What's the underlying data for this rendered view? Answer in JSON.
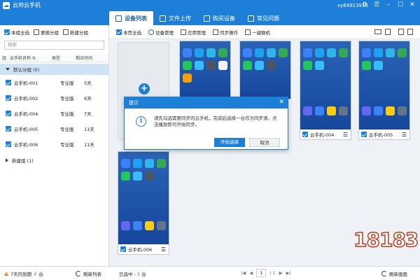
{
  "window": {
    "app_title": "云帅云手机",
    "account": "xy64913915",
    "controls": [
      "⚙",
      "☰",
      "–",
      "☐",
      "✕"
    ]
  },
  "tabs": [
    {
      "label": "设备列表",
      "active": true
    },
    {
      "label": "文件上传",
      "active": false
    },
    {
      "label": "购买设备",
      "active": false
    },
    {
      "label": "常见问题",
      "active": false
    }
  ],
  "left_toolbar": {
    "select_all": "本组全选",
    "change_group": "更换分组",
    "new_group": "新建分组"
  },
  "search": {
    "placeholder": "搜索"
  },
  "columns": {
    "group": "组",
    "name": "云手机名称 ⇅",
    "type": "类型",
    "remaining": "剩余时间"
  },
  "groups": [
    {
      "label": "默认分组 (5)",
      "expanded": true,
      "devices": [
        {
          "name": "云手机-001",
          "type": "专业版",
          "remaining": "5天",
          "checked": true
        },
        {
          "name": "云手机-002",
          "type": "专业版",
          "remaining": "6天",
          "checked": true
        },
        {
          "name": "云手机-004",
          "type": "专业版",
          "remaining": "7天",
          "checked": true
        },
        {
          "name": "云手机-005",
          "type": "专业版",
          "remaining": "11天",
          "checked": true
        },
        {
          "name": "云手机-006",
          "type": "专业版",
          "remaining": "11天",
          "checked": true
        }
      ]
    },
    {
      "label": "新建组 (1)",
      "expanded": false
    }
  ],
  "main_toolbar": {
    "page_select_all": "本页全选",
    "device_manage": "设备管理",
    "app_manage": "应用管理",
    "sync_op": "同步操作",
    "one_key_change": "一键换机"
  },
  "cards": [
    {
      "name": "",
      "visible_footer": false
    },
    {
      "name": "",
      "visible_footer": false
    },
    {
      "name": "云手机-004",
      "visible_footer": true
    },
    {
      "name": "云手机-005",
      "visible_footer": true
    },
    {
      "name": "云手机-006",
      "visible_footer": true
    }
  ],
  "dialog": {
    "title": "提示",
    "message": "请先勾选需要同步的云手机，完成后选择一台作为同步源，点击播放即可开始同步。",
    "primary": "开始选择",
    "secondary": "取消"
  },
  "status": {
    "expiring_prefix": "7天内到期",
    "expiring_count": "2",
    "expiring_suffix": "台",
    "refresh_list": "刷新列表",
    "selected_prefix": "已选中 -",
    "selected_count": "5",
    "selected_suffix": "台",
    "page_current": "1",
    "page_total": "/ 1",
    "refresh_screen": "刷新画面"
  },
  "watermark": "18183",
  "colors": {
    "accent": "#1e7fd9",
    "warn": "#f08a24",
    "danger": "#d9302c"
  }
}
